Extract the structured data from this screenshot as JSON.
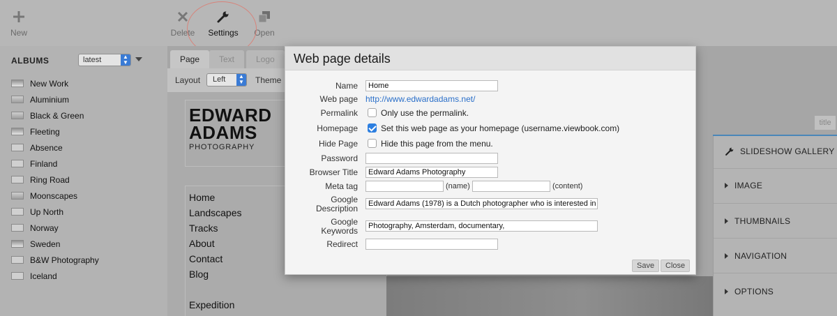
{
  "toolbar": {
    "new_label": "New",
    "delete_label": "Delete",
    "settings_label": "Settings",
    "open_label": "Open"
  },
  "sidebar": {
    "header": "ALBUMS",
    "sort_value": "latest",
    "items": [
      {
        "label": "New Work"
      },
      {
        "label": "Aluminium"
      },
      {
        "label": "Black & Green"
      },
      {
        "label": "Fleeting"
      },
      {
        "label": "Absence"
      },
      {
        "label": "Finland"
      },
      {
        "label": "Ring Road"
      },
      {
        "label": "Moonscapes"
      },
      {
        "label": "Up North"
      },
      {
        "label": "Norway"
      },
      {
        "label": "Sweden"
      },
      {
        "label": "B&W Photography"
      },
      {
        "label": "Iceland"
      }
    ]
  },
  "editor": {
    "tabs": [
      "Page",
      "Text",
      "Logo"
    ],
    "layout_label": "Layout",
    "layout_value": "Left",
    "theme_label": "Theme",
    "logo_line1": "EDWARD",
    "logo_line2": "ADAMS",
    "logo_sub": "PHOTOGRAPHY",
    "menu": [
      "Home",
      "Landscapes",
      "Tracks",
      "About",
      "Contact",
      "Blog",
      "Expedition"
    ]
  },
  "right_panel": {
    "title_chip": "title",
    "items": [
      "SLIDESHOW GALLERY",
      "IMAGE",
      "THUMBNAILS",
      "NAVIGATION",
      "OPTIONS"
    ]
  },
  "modal": {
    "title": "Web page details",
    "labels": {
      "name": "Name",
      "web_page": "Web page",
      "permalink": "Permalink",
      "homepage": "Homepage",
      "hide_page": "Hide Page",
      "password": "Password",
      "browser_title": "Browser Title",
      "meta_tag": "Meta tag",
      "google_description_1": "Google",
      "google_description_2": "Description",
      "google_keywords_1": "Google",
      "google_keywords_2": "Keywords",
      "redirect": "Redirect"
    },
    "values": {
      "name": "Home",
      "web_page_url": "http://www.edwardadams.net/",
      "permalink_text": "Only use the permalink.",
      "homepage_text": "Set this web page as your homepage (username.viewbook.com)",
      "hide_page_text": "Hide this page from the menu.",
      "password": "",
      "browser_title": "Edward Adams Photography",
      "meta_name": "",
      "meta_name_note": "(name)",
      "meta_content": "",
      "meta_content_note": "(content)",
      "google_description": "Edward Adams (1978) is a Dutch photographer who is interested in",
      "google_keywords": "Photography, Amsterdam, documentary,",
      "redirect": ""
    },
    "checkboxes": {
      "permalink": false,
      "homepage": true,
      "hide_page": false
    },
    "buttons": {
      "save": "Save",
      "close": "Close"
    }
  }
}
